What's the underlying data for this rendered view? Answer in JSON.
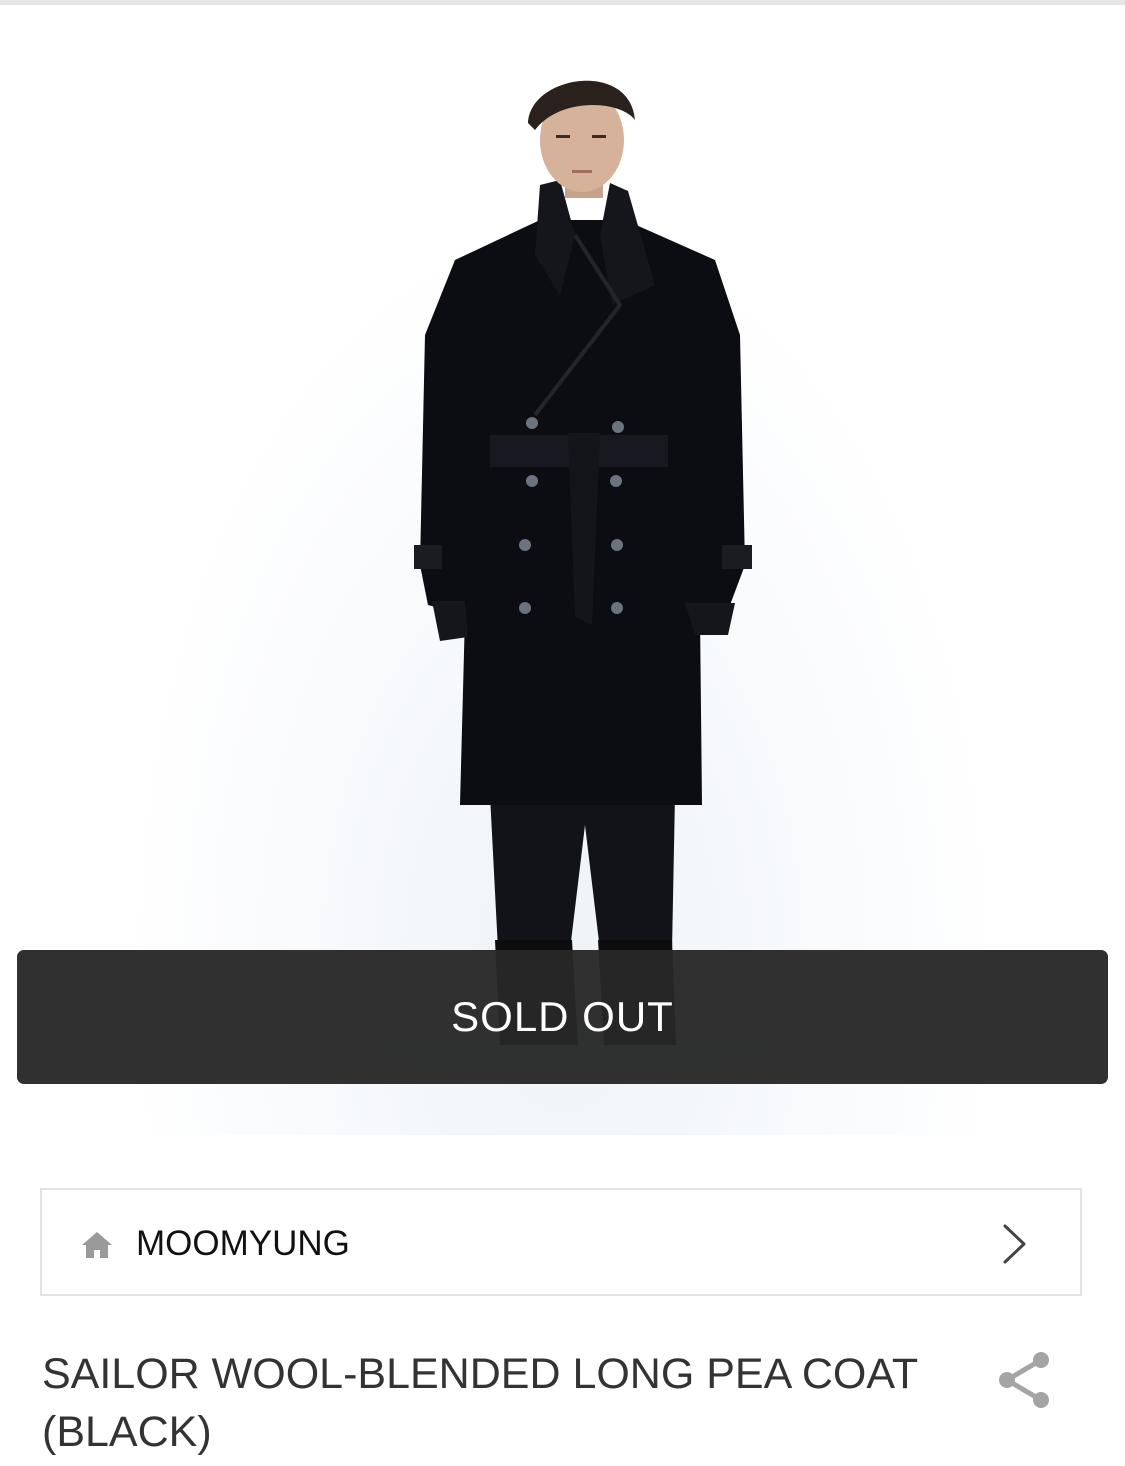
{
  "overlay": {
    "sold_out_label": "SOLD OUT"
  },
  "brand": {
    "name": "MOOMYUNG",
    "home_icon": "home-icon",
    "chevron_icon": "chevron-right-icon"
  },
  "product": {
    "title": "SAILOR WOOL-BLENDED LONG PEA COAT(BLACK)",
    "image_icon": "product-photo",
    "share_icon": "share-icon"
  },
  "colors": {
    "overlay_bg": "#282828",
    "overlay_text": "#ffffff",
    "icon_gray": "#9a9a9a",
    "border": "#e3e3e3"
  }
}
